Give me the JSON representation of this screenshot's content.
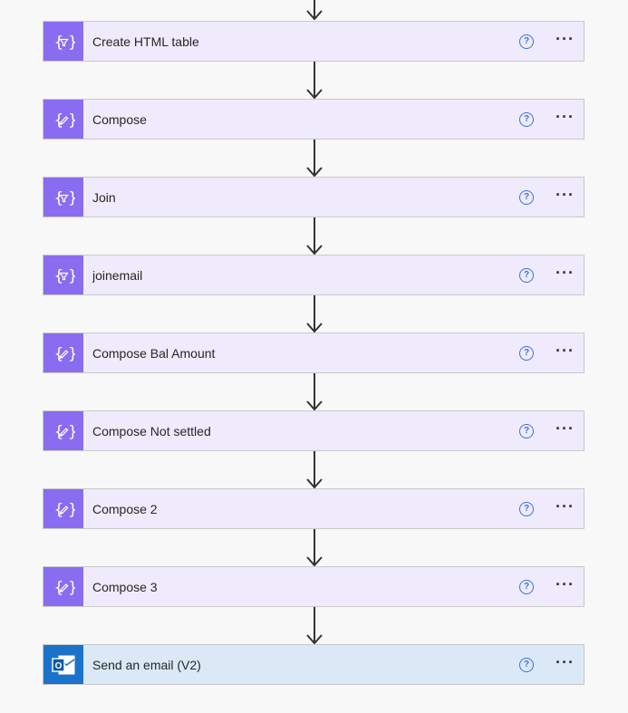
{
  "flow": {
    "steps": [
      {
        "label": "Create HTML table",
        "icon": "data-operation-icon",
        "kind": "data-op"
      },
      {
        "label": "Compose",
        "icon": "compose-icon",
        "kind": "compose"
      },
      {
        "label": "Join",
        "icon": "data-operation-icon",
        "kind": "data-op"
      },
      {
        "label": "joinemail",
        "icon": "data-operation-icon",
        "kind": "data-op"
      },
      {
        "label": "Compose Bal Amount",
        "icon": "compose-icon",
        "kind": "compose"
      },
      {
        "label": "Compose Not settled",
        "icon": "compose-icon",
        "kind": "compose"
      },
      {
        "label": "Compose 2",
        "icon": "compose-icon",
        "kind": "compose"
      },
      {
        "label": "Compose 3",
        "icon": "compose-icon",
        "kind": "compose"
      },
      {
        "label": "Send an email (V2)",
        "icon": "outlook-icon",
        "kind": "email"
      }
    ],
    "help_icon": "question-circle-icon",
    "more_icon": "ellipsis-icon"
  },
  "colors": {
    "action_card_bg": "#efeafc",
    "action_icon_bg": "#8a6cf0",
    "email_card_bg": "#dbe9f7",
    "email_icon_bg": "#1a73c9",
    "connector": "#333333",
    "help": "#3a72d8"
  }
}
